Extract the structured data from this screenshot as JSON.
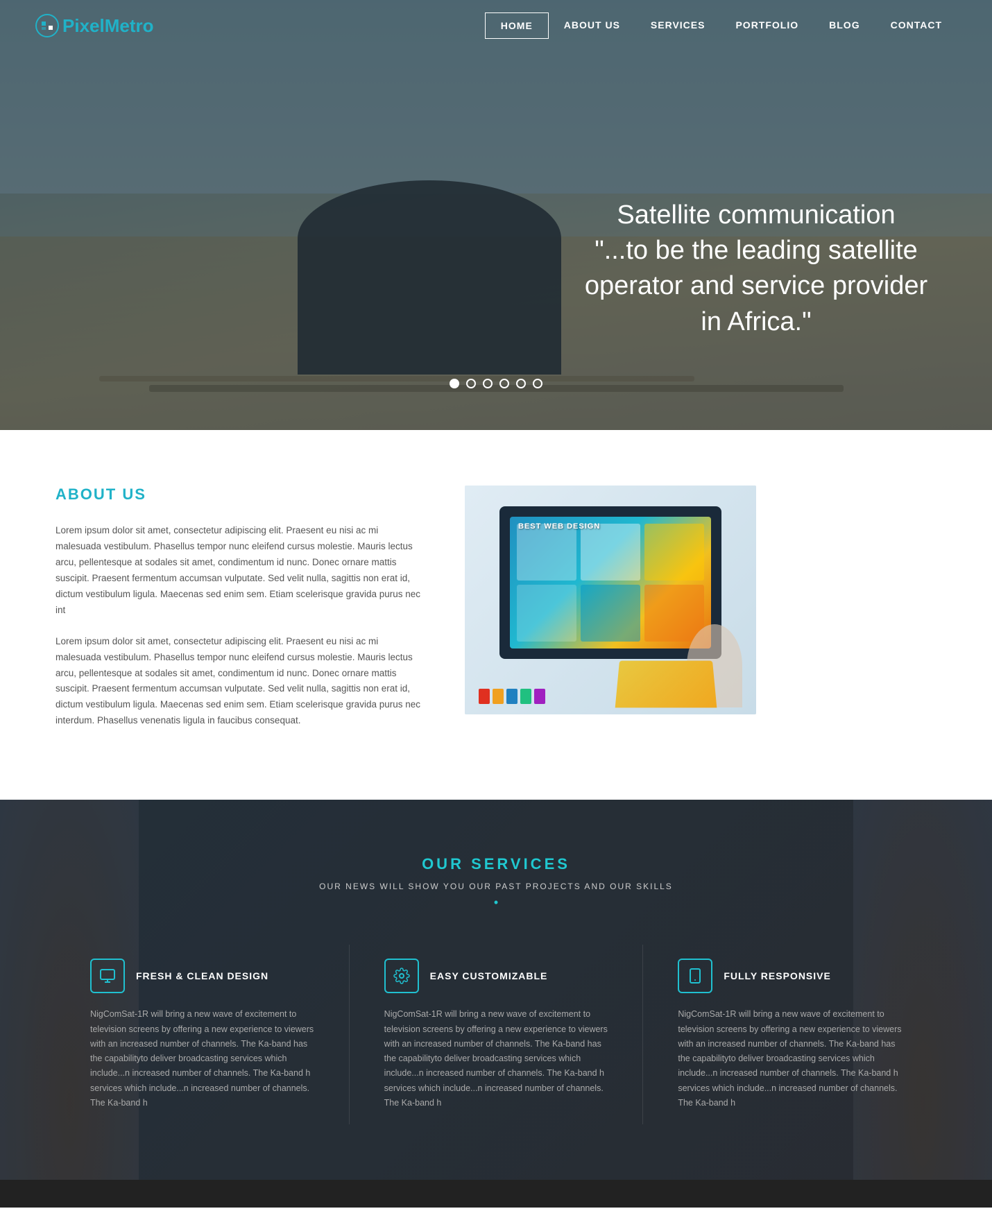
{
  "logo": {
    "brand": "Pixel",
    "brand2": "Metro",
    "icon": "pixel-icon"
  },
  "nav": {
    "items": [
      {
        "label": "HOME",
        "active": true
      },
      {
        "label": "ABOUT US",
        "active": false
      },
      {
        "label": "SERVICES",
        "active": false
      },
      {
        "label": "PORTFOLIO",
        "active": false
      },
      {
        "label": "BLOG",
        "active": false
      },
      {
        "label": "CONTACT",
        "active": false
      }
    ]
  },
  "hero": {
    "title": "Satellite communication",
    "subtitle": "\"...to be the leading satellite operator and service provider in Africa.\"",
    "dots": 6,
    "activeDot": 0
  },
  "about": {
    "heading": "ABOUT US",
    "para1": "Lorem ipsum dolor sit amet, consectetur adipiscing elit. Praesent eu nisi ac mi malesuada vestibulum. Phasellus tempor nunc eleifend cursus molestie. Mauris lectus arcu, pellentesque at sodales sit amet, condimentum id nunc. Donec ornare mattis suscipit. Praesent fermentum accumsan vulputate. Sed velit nulla, sagittis non erat id, dictum vestibulum ligula. Maecenas sed enim sem. Etiam scelerisque gravida purus nec int",
    "para2": "Lorem ipsum dolor sit amet, consectetur adipiscing elit. Praesent eu nisi ac mi malesuada vestibulum. Phasellus tempor nunc eleifend cursus molestie. Mauris lectus arcu, pellentesque at sodales sit amet, condimentum id nunc. Donec ornare mattis suscipit. Praesent fermentum accumsan vulputate. Sed velit nulla, sagittis non erat id, dictum vestibulum ligula. Maecenas sed enim sem. Etiam scelerisque gravida purus nec interdum. Phasellus venenatis ligula in faucibus consequat."
  },
  "services": {
    "heading": "OUR SERVICES",
    "subtitle": "OUR NEWS WILL SHOW YOU OUR PAST PROJECTS AND OUR SKILLS",
    "dot": "•",
    "items": [
      {
        "icon": "monitor-icon",
        "title": "FRESH & CLEAN DESIGN",
        "desc": "NigComSat-1R will bring a new wave of excitement to television screens by offering a new experience to viewers with an increased number of channels. The Ka-band has the capabilityto deliver broadcasting services which include...n increased number of channels. The Ka-band h services which include...n increased number of channels. The Ka-band h"
      },
      {
        "icon": "gear-icon",
        "title": "EASY CUSTOMIZABLE",
        "desc": "NigComSat-1R will bring a new wave of excitement to television screens by offering a new experience to viewers with an increased number of channels. The Ka-band has the capabilityto deliver broadcasting services which include...n increased number of channels. The Ka-band h services which include...n increased number of channels. The Ka-band h"
      },
      {
        "icon": "mobile-icon",
        "title": "FULLY RESPONSIVE",
        "desc": "NigComSat-1R will bring a new wave of excitement to television screens by offering a new experience to viewers with an increased number of channels. The Ka-band has the capabilityto deliver broadcasting services which include...n increased number of channels. The Ka-band h services which include...n increased number of channels. The Ka-band h"
      }
    ]
  }
}
